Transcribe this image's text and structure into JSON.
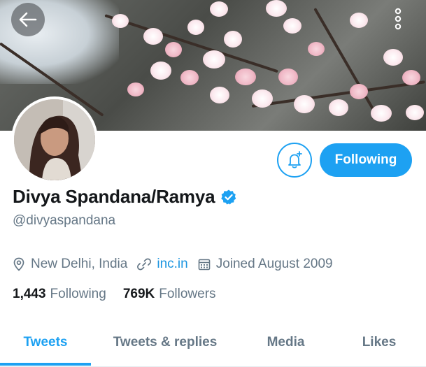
{
  "profile": {
    "display_name": "Divya Spandana/Ramya",
    "handle": "@divyaspandana",
    "location": "New Delhi, India",
    "website": "inc.in",
    "joined": "Joined August 2009",
    "verified": true
  },
  "actions": {
    "follow_label": "Following"
  },
  "stats": {
    "following_count": "1,443",
    "following_label": "Following",
    "followers_count": "769K",
    "followers_label": "Followers"
  },
  "tabs": [
    {
      "label": "Tweets",
      "active": true
    },
    {
      "label": "Tweets & replies",
      "active": false
    },
    {
      "label": "Media",
      "active": false
    },
    {
      "label": "Likes",
      "active": false
    }
  ],
  "colors": {
    "accent": "#1da1f2",
    "link": "#1b95e0",
    "secondary_text": "#657786",
    "primary_text": "#14171a"
  },
  "icons": {
    "back": "arrow-left-icon",
    "more": "more-vertical-icon",
    "bell": "bell-plus-icon",
    "verified": "verified-badge-icon",
    "location": "location-pin-icon",
    "link": "link-icon",
    "calendar": "calendar-icon"
  }
}
